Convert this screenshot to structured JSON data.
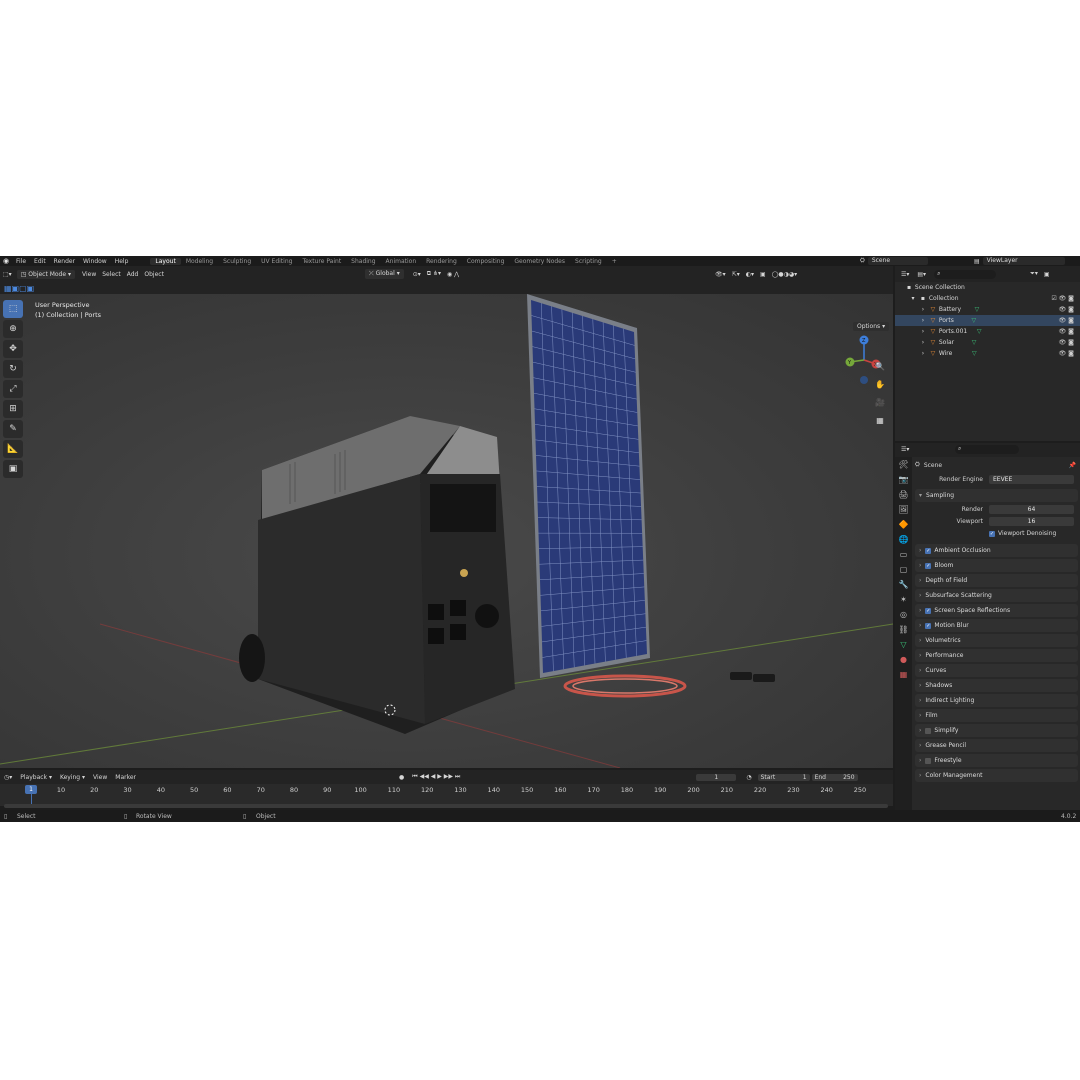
{
  "topbar": {
    "menu": [
      "File",
      "Edit",
      "Render",
      "Window",
      "Help"
    ],
    "workspace_tabs": [
      "Layout",
      "Modeling",
      "Sculpting",
      "UV Editing",
      "Texture Paint",
      "Shading",
      "Animation",
      "Rendering",
      "Compositing",
      "Geometry Nodes",
      "Scripting"
    ],
    "active_tab": "Layout",
    "scene": "Scene",
    "view_layer": "ViewLayer"
  },
  "viewport": {
    "mode": "Object Mode",
    "menus": [
      "View",
      "Select",
      "Add",
      "Object"
    ],
    "orientation": "Global",
    "options": "Options",
    "perspective_label": "User Perspective",
    "collection_label": "(1) Collection | Ports",
    "tools": [
      "select",
      "cursor",
      "move",
      "rotate",
      "scale",
      "transform",
      "annotate",
      "measure",
      "add-cube"
    ],
    "active_tool": "select",
    "gizmo_axes": [
      "Y",
      "X",
      "Z"
    ],
    "nav_buttons": [
      "zoom",
      "pan",
      "camera",
      "perspective"
    ],
    "colors": {
      "x_axis": "#c8423f",
      "y_axis": "#76a83a",
      "z_axis": "#3d7edb",
      "accent": "#4772b3"
    }
  },
  "timeline": {
    "menus": [
      "Playback",
      "Keying",
      "View",
      "Marker"
    ],
    "current_frame": "1",
    "start_label": "Start",
    "start": "1",
    "end_label": "End",
    "end": "250",
    "ticks": [
      "1",
      "10",
      "20",
      "30",
      "40",
      "50",
      "60",
      "70",
      "80",
      "90",
      "100",
      "110",
      "120",
      "130",
      "140",
      "150",
      "160",
      "170",
      "180",
      "190",
      "200",
      "210",
      "220",
      "230",
      "240",
      "250"
    ]
  },
  "status": {
    "select": "Select",
    "rotate": "Rotate View",
    "object": "Object",
    "version": "4.0.2"
  },
  "outliner": {
    "root": "Scene Collection",
    "collection": "Collection",
    "items": [
      {
        "name": "Battery"
      },
      {
        "name": "Ports"
      },
      {
        "name": "Ports.001"
      },
      {
        "name": "Solar"
      },
      {
        "name": "Wire"
      }
    ]
  },
  "properties": {
    "context": "Scene",
    "render_engine_label": "Render Engine",
    "render_engine": "EEVEE",
    "sampling": {
      "title": "Sampling",
      "render_label": "Render",
      "render": "64",
      "viewport_label": "Viewport",
      "viewport": "16",
      "denoise_label": "Viewport Denoising",
      "denoise": true
    },
    "panels": [
      {
        "label": "Ambient Occlusion",
        "checkbox": true
      },
      {
        "label": "Bloom",
        "checkbox": true
      },
      {
        "label": "Depth of Field",
        "checkbox": null
      },
      {
        "label": "Subsurface Scattering",
        "checkbox": null
      },
      {
        "label": "Screen Space Reflections",
        "checkbox": true
      },
      {
        "label": "Motion Blur",
        "checkbox": true
      },
      {
        "label": "Volumetrics",
        "checkbox": null
      },
      {
        "label": "Performance",
        "checkbox": null
      },
      {
        "label": "Curves",
        "checkbox": null
      },
      {
        "label": "Shadows",
        "checkbox": null
      },
      {
        "label": "Indirect Lighting",
        "checkbox": null
      },
      {
        "label": "Film",
        "checkbox": null
      },
      {
        "label": "Simplify",
        "checkbox": false
      },
      {
        "label": "Grease Pencil",
        "checkbox": null
      },
      {
        "label": "Freestyle",
        "checkbox": false
      },
      {
        "label": "Color Management",
        "checkbox": null
      }
    ]
  }
}
